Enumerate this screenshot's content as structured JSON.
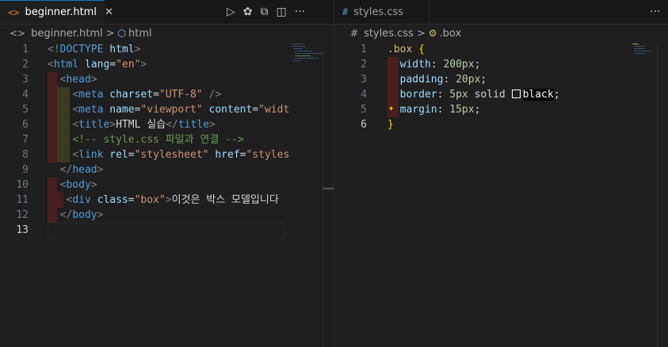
{
  "left_editor": {
    "tab": {
      "icon": "<>",
      "label": "beginner.html",
      "close": "✕"
    },
    "actions": [
      "▷",
      "✿",
      "⧉",
      "◫",
      "···"
    ],
    "breadcrumb": {
      "file_icon": "<>",
      "file": "beginner.html",
      "sep": ">",
      "symbol_icon": "⬡",
      "symbol": "html"
    },
    "lines": [
      {
        "n": "1",
        "tokens": [
          [
            "br",
            "<!"
          ],
          [
            "tag",
            "DOCTYPE"
          ],
          [
            "txt",
            " "
          ],
          [
            "attr",
            "html"
          ],
          [
            "br",
            ">"
          ]
        ]
      },
      {
        "n": "2",
        "tokens": [
          [
            "br",
            "<"
          ],
          [
            "tag",
            "html"
          ],
          [
            "txt",
            " "
          ],
          [
            "attr",
            "lang"
          ],
          [
            "txt",
            "="
          ],
          [
            "str",
            "\"en\""
          ],
          [
            "br",
            ">"
          ]
        ]
      },
      {
        "n": "3",
        "tokens": [
          [
            "txt",
            "  "
          ],
          [
            "br",
            "<"
          ],
          [
            "tag",
            "head"
          ],
          [
            "br",
            ">"
          ]
        ]
      },
      {
        "n": "4",
        "tokens": [
          [
            "txt",
            "    "
          ],
          [
            "br",
            "<"
          ],
          [
            "tag",
            "meta"
          ],
          [
            "txt",
            " "
          ],
          [
            "attr",
            "charset"
          ],
          [
            "txt",
            "="
          ],
          [
            "str",
            "\"UTF-8\""
          ],
          [
            "txt",
            " "
          ],
          [
            "br",
            "/>"
          ]
        ]
      },
      {
        "n": "5",
        "tokens": [
          [
            "txt",
            "    "
          ],
          [
            "br",
            "<"
          ],
          [
            "tag",
            "meta"
          ],
          [
            "txt",
            " "
          ],
          [
            "attr",
            "name"
          ],
          [
            "txt",
            "="
          ],
          [
            "str",
            "\"viewport\""
          ],
          [
            "txt",
            " "
          ],
          [
            "attr",
            "content"
          ],
          [
            "txt",
            "="
          ],
          [
            "str",
            "\"widt"
          ]
        ]
      },
      {
        "n": "6",
        "tokens": [
          [
            "txt",
            "    "
          ],
          [
            "br",
            "<"
          ],
          [
            "tag",
            "title"
          ],
          [
            "br",
            ">"
          ],
          [
            "txt",
            "HTML 실습"
          ],
          [
            "br",
            "</"
          ],
          [
            "tag",
            "title"
          ],
          [
            "br",
            ">"
          ]
        ]
      },
      {
        "n": "7",
        "tokens": [
          [
            "txt",
            "    "
          ],
          [
            "com",
            "<!-- style.css 파일과 연결 -->"
          ]
        ]
      },
      {
        "n": "8",
        "tokens": [
          [
            "txt",
            "    "
          ],
          [
            "br",
            "<"
          ],
          [
            "tag",
            "link"
          ],
          [
            "txt",
            " "
          ],
          [
            "attr",
            "rel"
          ],
          [
            "txt",
            "="
          ],
          [
            "str",
            "\"stylesheet\""
          ],
          [
            "txt",
            " "
          ],
          [
            "attr",
            "href"
          ],
          [
            "txt",
            "="
          ],
          [
            "str",
            "\"styles"
          ]
        ]
      },
      {
        "n": "9",
        "tokens": [
          [
            "txt",
            "  "
          ],
          [
            "br",
            "</"
          ],
          [
            "tag",
            "head"
          ],
          [
            "br",
            ">"
          ]
        ]
      },
      {
        "n": "10",
        "tokens": [
          [
            "txt",
            "  "
          ],
          [
            "br",
            "<"
          ],
          [
            "tag",
            "body"
          ],
          [
            "br",
            ">"
          ]
        ]
      },
      {
        "n": "11",
        "tokens": [
          [
            "txt",
            "   "
          ],
          [
            "br",
            "<"
          ],
          [
            "tag",
            "div"
          ],
          [
            "txt",
            " "
          ],
          [
            "attr",
            "class"
          ],
          [
            "txt",
            "="
          ],
          [
            "str",
            "\"box\""
          ],
          [
            "br",
            ">"
          ],
          [
            "txt",
            "이것은 박스 모델입니다"
          ]
        ]
      },
      {
        "n": "12",
        "tokens": [
          [
            "txt",
            "  "
          ],
          [
            "br",
            "</"
          ],
          [
            "tag",
            "body"
          ],
          [
            "br",
            ">"
          ]
        ]
      },
      {
        "n": "13",
        "tokens": []
      }
    ]
  },
  "right_editor": {
    "tab": {
      "icon": "#",
      "label": "styles.css"
    },
    "actions": [
      "···"
    ],
    "breadcrumb": {
      "file_icon": "#",
      "file": "styles.css",
      "sep": ">",
      "symbol_icon": "⚙",
      "symbol": ".box"
    },
    "lines": [
      {
        "n": "1",
        "tokens": [
          [
            "sel",
            ".box"
          ],
          [
            "txt",
            " "
          ],
          [
            "brace",
            "{"
          ]
        ]
      },
      {
        "n": "2",
        "tokens": [
          [
            "txt",
            "  "
          ],
          [
            "prop",
            "width"
          ],
          [
            "txt",
            ": "
          ],
          [
            "num",
            "200px"
          ],
          [
            "txt",
            ";"
          ]
        ]
      },
      {
        "n": "3",
        "tokens": [
          [
            "txt",
            "  "
          ],
          [
            "prop",
            "padding"
          ],
          [
            "txt",
            ": "
          ],
          [
            "num",
            "20px"
          ],
          [
            "txt",
            ";"
          ]
        ]
      },
      {
        "n": "4",
        "tokens": [
          [
            "txt",
            "  "
          ],
          [
            "prop",
            "border"
          ],
          [
            "txt",
            ": "
          ],
          [
            "num",
            "5px"
          ],
          [
            "txt",
            " solid "
          ],
          [
            "swatch",
            ""
          ],
          [
            "color",
            "black"
          ],
          [
            "txt",
            ";"
          ]
        ]
      },
      {
        "n": "5",
        "tokens": [
          [
            "txt",
            "  "
          ],
          [
            "prop",
            "margin"
          ],
          [
            "txt",
            ": "
          ],
          [
            "num",
            "15px"
          ],
          [
            "txt",
            ";"
          ]
        ]
      },
      {
        "n": "6",
        "tokens": [
          [
            "brace",
            "}"
          ]
        ]
      }
    ],
    "bulb_icon": "✦"
  },
  "colors": {
    "accent": "#0078d4",
    "bg": "#1f1f1f",
    "tabbar": "#181818"
  }
}
